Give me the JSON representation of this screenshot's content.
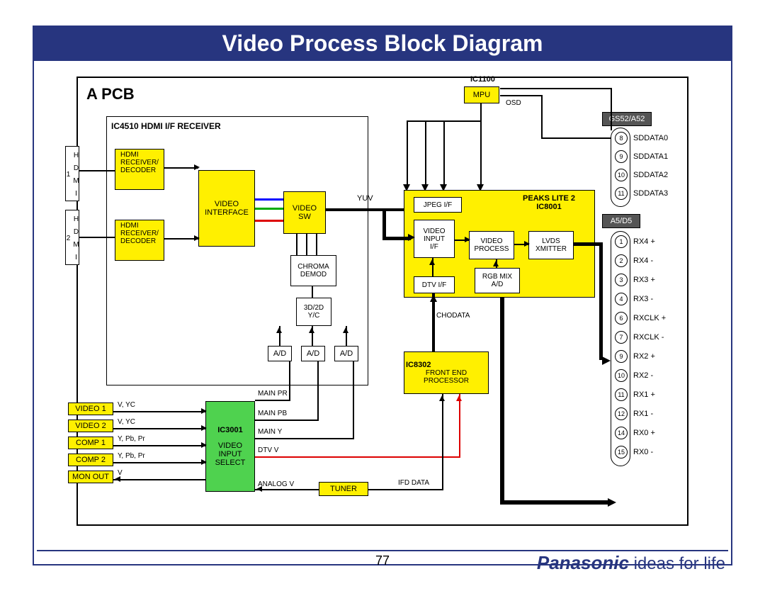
{
  "title": "Video Process Block Diagram",
  "page": "77",
  "brand_name": "Panasonic",
  "brand_tag": "ideas for life",
  "pcb_label": "A PCB",
  "ic4510_label": "IC4510 HDMI I/F RECEIVER",
  "hdmi1": "HDMI\nRECEIVER/\nDECODER",
  "hdmi2": "HDMI\nRECEIVER/\nDECODER",
  "hdmi_port1": "H D M I 1",
  "hdmi_port2": "H D M I 2",
  "video_interface": "VIDEO\nINTERFACE",
  "video_sw": "VIDEO\nSW",
  "chroma": "CHROMA\nDEMOD",
  "y3d2d": "3D/2D\nY/C",
  "ad": "A/D",
  "yuv": "YUV",
  "ic1100": "IC1100",
  "mpu": "MPU",
  "osd": "OSD",
  "peaks": "PEAKS LITE 2\nIC8001",
  "jpeg": "JPEG I/F",
  "vinput": "VIDEO\nINPUT\nI/F",
  "vprocess": "VIDEO\nPROCESS",
  "lvds": "LVDS\nXMITTER",
  "dtvif": "DTV I/F",
  "rgbmix": "RGB MIX\nA/D",
  "chodata": "CHODATA",
  "ic8302": "IC8302",
  "frontend": "FRONT END\nPROCESSOR",
  "ic3001": "IC3001",
  "vis": "VIDEO\nINPUT\nSELECT",
  "tuner": "TUNER",
  "video1": "VIDEO 1",
  "video2": "VIDEO 2",
  "comp1": "COMP 1",
  "comp2": "COMP 2",
  "monout": "MON OUT",
  "v_yc": "V, YC",
  "ypbpr": "Y, Pb, Pr",
  "v": "V",
  "main_pr": "MAIN PR",
  "main_pb": "MAIN PB",
  "main_y": "MAIN Y",
  "dtv_v": "DTV V",
  "analog_v": "ANALOG V",
  "ifd_data": "IFD DATA",
  "gs52": "GS52/A52",
  "a5d5": "A5/D5",
  "sd": [
    "SDDATA0",
    "SDDATA1",
    "SDDATA2",
    "SDDATA3"
  ],
  "sd_pins": [
    "8",
    "9",
    "10",
    "11"
  ],
  "rx": [
    "RX4 +",
    "RX4 -",
    "RX3 +",
    "RX3 -",
    "RXCLK +",
    "RXCLK -",
    "RX2 +",
    "RX2 -",
    "RX1 +",
    "RX1 -",
    "RX0 +",
    "RX0 -"
  ],
  "rx_pins": [
    "1",
    "2",
    "3",
    "4",
    "6",
    "7",
    "9",
    "10",
    "11",
    "12",
    "14",
    "15"
  ]
}
